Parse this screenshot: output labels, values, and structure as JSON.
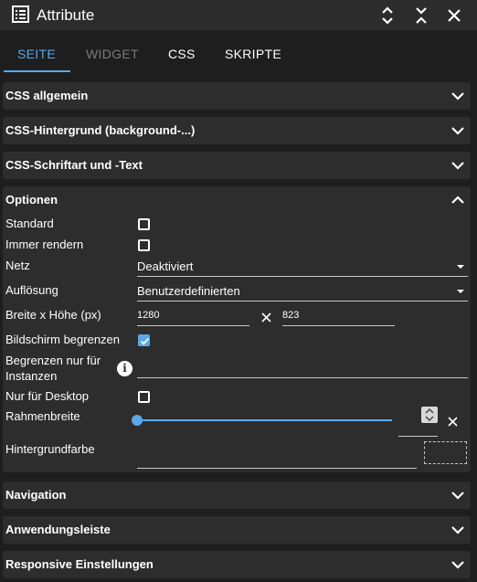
{
  "window": {
    "title": "Attribute"
  },
  "tabs": [
    {
      "label": "SEITE"
    },
    {
      "label": "WIDGET"
    },
    {
      "label": "CSS"
    },
    {
      "label": "SKRIPTE"
    }
  ],
  "panels": {
    "css_general": "CSS allgemein",
    "css_background": "CSS-Hintergrund (background-...)",
    "css_font": "CSS-Schriftart und -Text",
    "options": "Optionen",
    "navigation": "Navigation",
    "app_bar": "Anwendungsleiste",
    "responsive": "Responsive Einstellungen"
  },
  "options": {
    "standard": {
      "label": "Standard",
      "checked": false
    },
    "always_render": {
      "label": "Immer rendern",
      "checked": false
    },
    "grid": {
      "label": "Netz",
      "value": "Deaktiviert"
    },
    "resolution": {
      "label": "Auflösung",
      "value": "Benutzerdefinierten"
    },
    "size": {
      "label": "Breite x Höhe (px)",
      "width": "1280",
      "height": "823"
    },
    "limit_screen": {
      "label": "Bildschirm begrenzen",
      "checked": true
    },
    "limit_instances": {
      "label_line1": "Begrenzen nur für",
      "label_line2": "Instanzen",
      "value": ""
    },
    "desktop_only": {
      "label": "Nur für Desktop",
      "checked": false
    },
    "border_width": {
      "label": "Rahmenbreite",
      "value": 0
    },
    "background_color": {
      "label": "Hintergrundfarbe",
      "value": ""
    }
  },
  "colors": {
    "accent": "#5aa8e8",
    "panel": "#2d2d2d",
    "background": "#1e1e1e"
  },
  "icons": {
    "title": "list-icon",
    "collapse_all": "unfold-less-icon",
    "expand_all": "unfold-more-icon",
    "close": "close-icon"
  }
}
